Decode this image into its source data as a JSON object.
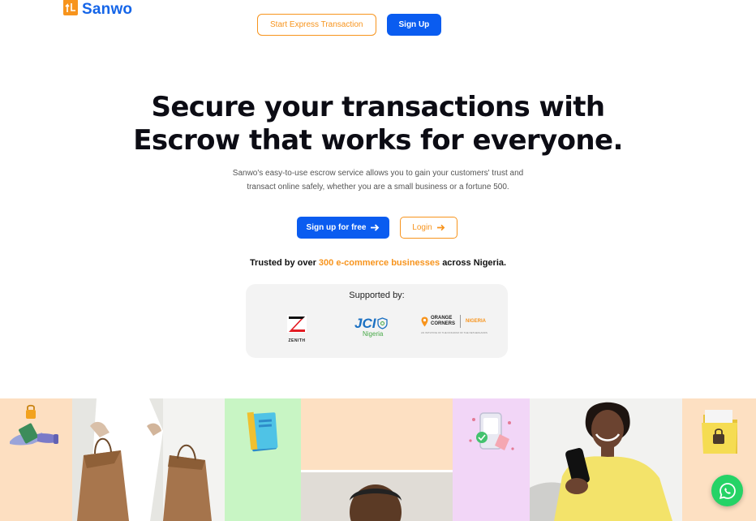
{
  "header": {
    "brand": "Sanwo",
    "express_label": "Start Express Transaction",
    "signup_label": "Sign Up"
  },
  "hero": {
    "title_line1": "Secure your transactions with",
    "title_line2": "Escrow that works for everyone.",
    "subtitle_line1": "Sanwo's easy-to-use escrow service allows you to gain your customers' trust and",
    "subtitle_line2": "transact online safely, whether you are a small business or a fortune 500.",
    "cta_primary": "Sign up for free",
    "cta_secondary": "Login"
  },
  "trust": {
    "prefix": "Trusted by over",
    "highlight": "300 e-commerce businesses",
    "suffix": "across Nigeria."
  },
  "supported": {
    "title": "Supported by:",
    "zenith": "ZENITH",
    "jci_main": "JCI",
    "jci_sub": "Nigeria",
    "oc_line1": "ORANGE",
    "oc_line2": "CORNERS",
    "oc_country": "NIGERIA",
    "oc_tag": "AN INITIATIVE OF THE KINGDOM OF THE NETHERLANDS"
  },
  "colors": {
    "brand_blue": "#0a5cf0",
    "brand_orange": "#f7941d",
    "whatsapp_green": "#25d366"
  },
  "icons": {
    "arrow": "arrow-right-icon",
    "chat": "whatsapp-icon"
  }
}
